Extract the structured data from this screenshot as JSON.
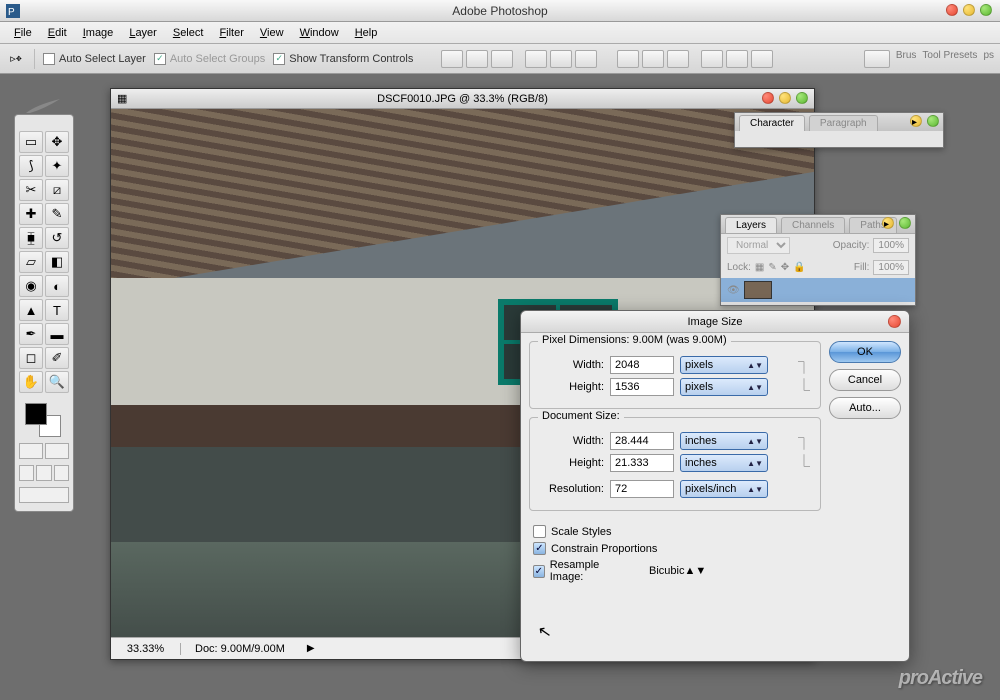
{
  "app": {
    "title": "Adobe Photoshop"
  },
  "menu": [
    "File",
    "Edit",
    "Image",
    "Layer",
    "Select",
    "Filter",
    "View",
    "Window",
    "Help"
  ],
  "options": {
    "auto_select_layer": "Auto Select Layer",
    "auto_select_groups": "Auto Select Groups",
    "show_transform": "Show Transform Controls",
    "right_tabs": [
      "Brus",
      "Tool Presets",
      "ps"
    ]
  },
  "doc": {
    "title": "DSCF0010.JPG @ 33.3% (RGB/8)",
    "zoom": "33.33%",
    "status": "Doc: 9.00M/9.00M"
  },
  "char_panel": {
    "tabs": [
      "Character",
      "Paragraph"
    ]
  },
  "layers_panel": {
    "tabs": [
      "Layers",
      "Channels",
      "Paths"
    ],
    "blend": "Normal",
    "opacity_label": "Opacity:",
    "opacity": "100%",
    "lock_label": "Lock:",
    "fill_label": "Fill:",
    "fill": "100%"
  },
  "dialog": {
    "title": "Image Size",
    "pixel_legend": "Pixel Dimensions:  9.00M (was 9.00M)",
    "doc_legend": "Document Size:",
    "width_label": "Width:",
    "height_label": "Height:",
    "res_label": "Resolution:",
    "px_width": "2048",
    "px_height": "1536",
    "px_unit": "pixels",
    "doc_width": "28.444",
    "doc_height": "21.333",
    "doc_unit": "inches",
    "res": "72",
    "res_unit": "pixels/inch",
    "scale_styles": "Scale Styles",
    "constrain": "Constrain Proportions",
    "resample": "Resample Image:",
    "resample_method": "Bicubic",
    "ok": "OK",
    "cancel": "Cancel",
    "auto": "Auto..."
  },
  "watermark": "proActive"
}
